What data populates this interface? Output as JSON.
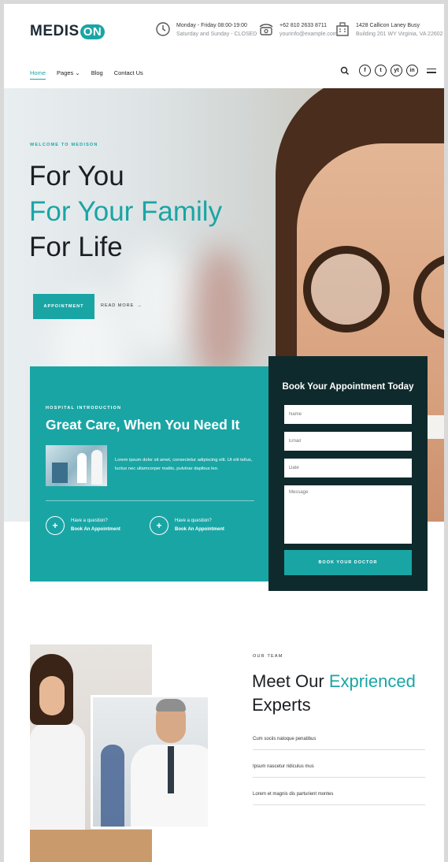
{
  "brand": {
    "name_prefix": "MEDIS",
    "name_suffix": "ON"
  },
  "header": {
    "hours": {
      "line1": "Monday - Friday 08:00-19:00",
      "line2": "Saturday and Sunday - CLOSED"
    },
    "contact": {
      "line1": "+62 810 2633 8711",
      "line2": "yourinfo@example.com"
    },
    "address": {
      "line1": "1428 Callicon Laney Busy",
      "line2": "Building 201 WY Virginia, VA 22602"
    }
  },
  "nav": {
    "items": [
      "Home",
      "Pages",
      "Blog",
      "Contact Us"
    ],
    "social": [
      "f",
      "t",
      "yt",
      "in"
    ]
  },
  "hero": {
    "kicker": "WELCOME TO MEDISON",
    "line1": "For You",
    "line2": "For Your Family",
    "line3": "For Life",
    "cta": "APPOINTMENT",
    "read_more": "READ MORE"
  },
  "intro": {
    "kicker": "HOSPITAL INTRODUCTION",
    "title": "Great Care, When You Need It",
    "description": "Lorem ipsum dolor sit amet, consectetur adipiscing elit. Ut elit tellus, luctus nec ullamcorper mattis, pulvinar dapibus leo.",
    "questions": [
      {
        "line1": "Have a question?",
        "line2": "Book An Appointment"
      },
      {
        "line1": "Have a question?",
        "line2": "Book An Appointment"
      }
    ]
  },
  "booking": {
    "title": "Book Your Appointment Today",
    "name_placeholder": "Name",
    "email_placeholder": "Email",
    "date_placeholder": "Date",
    "message_placeholder": "Message",
    "button": "BOOK YOUR DOCTOR"
  },
  "team": {
    "kicker": "OUR TEAM",
    "title_part1": "Meet Our ",
    "title_accent": "Exprienced",
    "title_part2": "Experts",
    "items": [
      "Cum sociis natoque penatibus",
      "Ipsum nascetur ridiculus mus",
      "Lorem et magnis dis parturient montes"
    ]
  },
  "colors": {
    "accent": "#1aa5a5",
    "dark": "#0f2a2c",
    "text": "#1b1f23"
  }
}
